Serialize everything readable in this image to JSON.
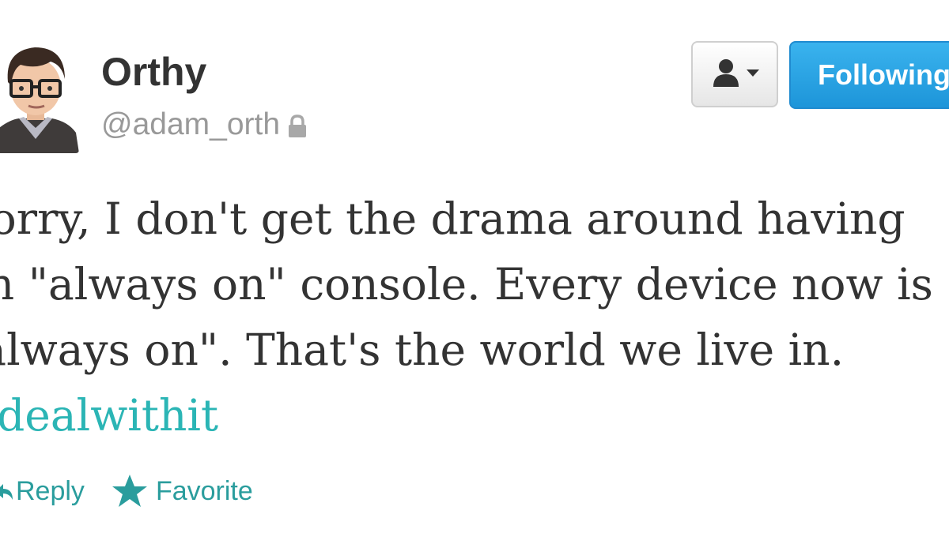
{
  "user": {
    "display_name": "Orthy",
    "screen_name": "@adam_orth",
    "protected_icon": "lock-icon",
    "avatar_icon": "cartoon-avatar"
  },
  "buttons": {
    "user_actions_icon": "person-dropdown-icon",
    "follow_label": "Following"
  },
  "tweet": {
    "lines": [
      "Sorry, I don't get the drama around having",
      "an \"always on\" console. Every device now is",
      "\"always on\". That's the world we live in."
    ],
    "hashtag": "#dealwithit"
  },
  "actions": {
    "reply_label": "Reply",
    "favorite_label": "Favorite"
  },
  "colors": {
    "link_teal": "#2bb5b5",
    "follow_blue": "#1d95d9",
    "text": "#333333",
    "muted": "#999999"
  }
}
